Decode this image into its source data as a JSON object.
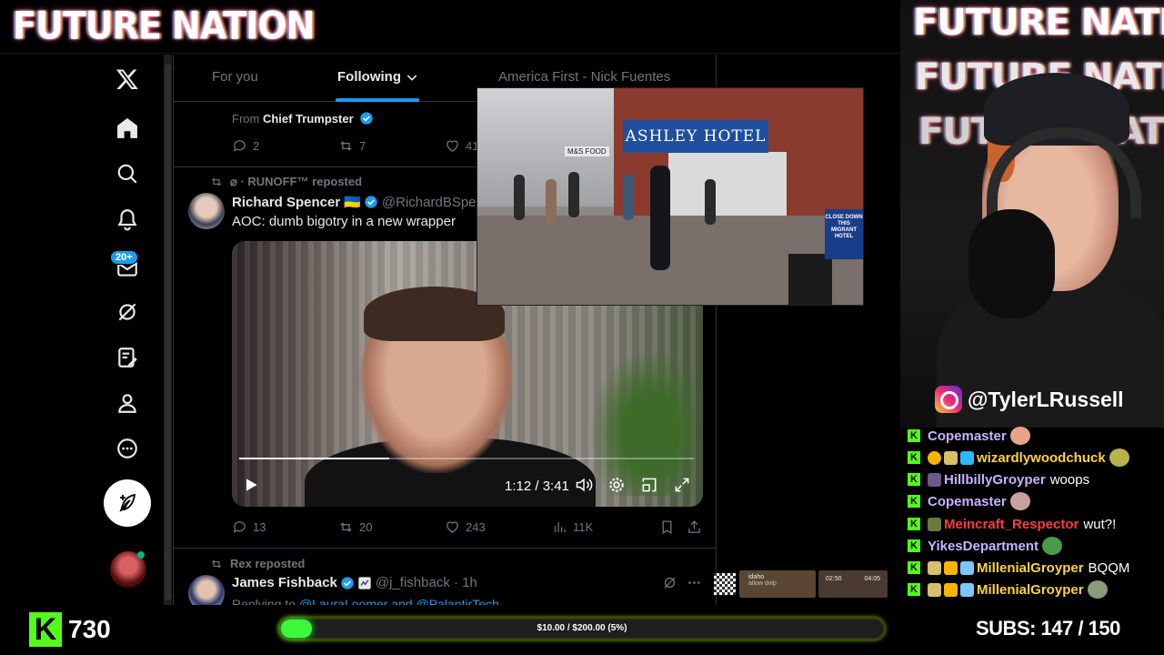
{
  "stream": {
    "title_logo": "FUTURE NATION",
    "cam_logo": "FUTURE NATION",
    "cam_logo_partial_1": "FUTURE NATION",
    "cam_logo_partial_2": "FUTURE NATION",
    "instagram_handle": "@TylerLRussell",
    "kick_followers": "730",
    "goal_text": "$10.00 / $200.00 (5%)",
    "goal_progress_fraction": 0.05,
    "subs_text": "SUBS:  147 / 150",
    "colors": {
      "kick_green": "#53fc18",
      "x_blue": "#1d9bf0"
    }
  },
  "sidebar": {
    "icons": [
      "x-logo-icon",
      "home-icon",
      "search-icon",
      "notifications-icon",
      "messages-icon",
      "grok-icon",
      "lists-icon",
      "profile-icon",
      "more-icon"
    ],
    "messages_badge": "20+"
  },
  "feed": {
    "tabs": [
      {
        "label": "For you"
      },
      {
        "label": "Following"
      },
      {
        "label": "America First - Nick Fuentes"
      }
    ],
    "post1": {
      "from_prefix": "From",
      "from_name": "Chief Trumpster",
      "replies": "2",
      "reposts": "7",
      "likes": "41"
    },
    "post2": {
      "repost_by": "⌀ · RUNOFF™ reposted",
      "name": "Richard Spencer",
      "flag": "🇺🇦",
      "handle": "@RichardBSpencer",
      "text": "AOC: dumb bigotry in a new wrapper",
      "video_time": "1:12 / 3:41",
      "video_progress_fraction": 0.33,
      "replies": "13",
      "reposts": "20",
      "likes": "243",
      "views": "11K"
    },
    "post3": {
      "repost_by": "Rex reposted",
      "name": "James Fishback",
      "handle": "@j_fishback · 1h",
      "reply_prefix": "Replying to",
      "reply_to": "@LauraLoomer and @PalantirTech"
    }
  },
  "overlay_video": {
    "hotel_sign": "ASHLEY HOTEL",
    "store_sign": "M&S FOOD",
    "protest_sign": "CLOSE DOWN THIS MIGRANT HOTEL"
  },
  "chat": [
    {
      "user": "Copemaster",
      "color": "#c9b1ff",
      "message": ""
    },
    {
      "user": "wizardlywoodchuck",
      "color": "#ffd23c",
      "message": ""
    },
    {
      "user": "HillbillyGroyper",
      "color": "#c9b1ff",
      "message": "woops"
    },
    {
      "user": "Copemaster",
      "color": "#c9b1ff",
      "message": ""
    },
    {
      "user": "Meincraft_Respector",
      "color": "#ff3b3b",
      "message": "wut?!"
    },
    {
      "user": "YikesDepartment",
      "color": "#c9b1ff",
      "message": ""
    },
    {
      "user": "MillenialGroyper",
      "color": "#ffd23c",
      "message": "BQQM"
    },
    {
      "user": "MillenialGroyper",
      "color": "#ffd23c",
      "message": ""
    }
  ],
  "widgets": {
    "w1_title": "idaho",
    "w1_sub": "allow dvlp",
    "w2_left": "02:50",
    "w2_right": "04:05"
  }
}
